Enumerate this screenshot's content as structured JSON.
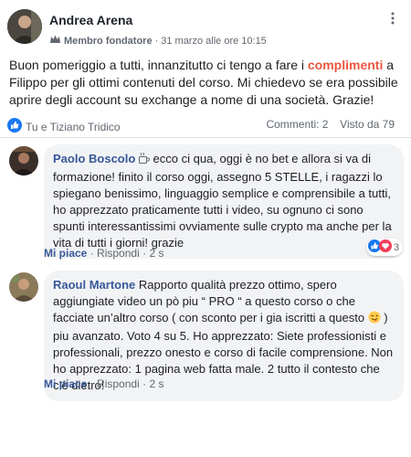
{
  "post": {
    "author": "Andrea Arena",
    "role": "Membro fondatore",
    "date": "31 marzo alle ore 10:15",
    "text_before": "Buon pomeriggio a tutti, innanzitutto ci tengo a fare i ",
    "text_highlight": "complimenti",
    "text_after": " a Filippo per gli ottimi contenuti del corso. Mi chiedevo se era possibile aprire degli account su exchange a nome di una società. Grazie!",
    "likes_text": "Tu e Tiziano Tridico",
    "comments_text": "Commenti: 2",
    "views_text": "Visto da 79"
  },
  "comments": [
    {
      "author": "Paolo Boscolo",
      "text": " ecco ci qua, oggi è no bet e allora si va di formazione! finito il corso oggi, assegno 5 STELLE, i ragazzi lo spiegano benissimo, linguaggio semplice e comprensibile a tutti, ho apprezzato praticamente tutti i video, su ognuno ci sono spunti interessantissimi ovviamente sulle crypto ma anche per la vita di tutti i giorni! grazie",
      "like_label": "Mi piace",
      "reply_label": "Rispondi",
      "time": "2 s",
      "reactions_count": "3"
    },
    {
      "author": "Raoul Martone",
      "text_before": " Rapporto qualità prezzo ottimo, spero aggiungiate video un pò piu “ PRO “ a questo corso o che facciate un’altro corso ( con sconto per i gia iscritti a questo ",
      "text_after": " ) piu avanzato. Voto 4 su 5. Ho apprezzato: Siete professionisti e professionali, prezzo onesto e corso di facile comprensione. Non ho apprezzato: 1 pagina web fatta male. 2 tutto il contesto che c’è dietro!",
      "like_label": "Mi piace",
      "reply_label": "Rispondi",
      "time": "2 s"
    }
  ],
  "colors": {
    "accent": "#385898",
    "highlight": "#e9573f",
    "like_blue": "#1877f2",
    "heart_red": "#f33e58"
  },
  "icons": [
    "more-vertical-icon",
    "founder-badge-icon",
    "like-reaction-icon",
    "coffee-icon",
    "heart-reaction-icon",
    "winking-face-icon"
  ]
}
